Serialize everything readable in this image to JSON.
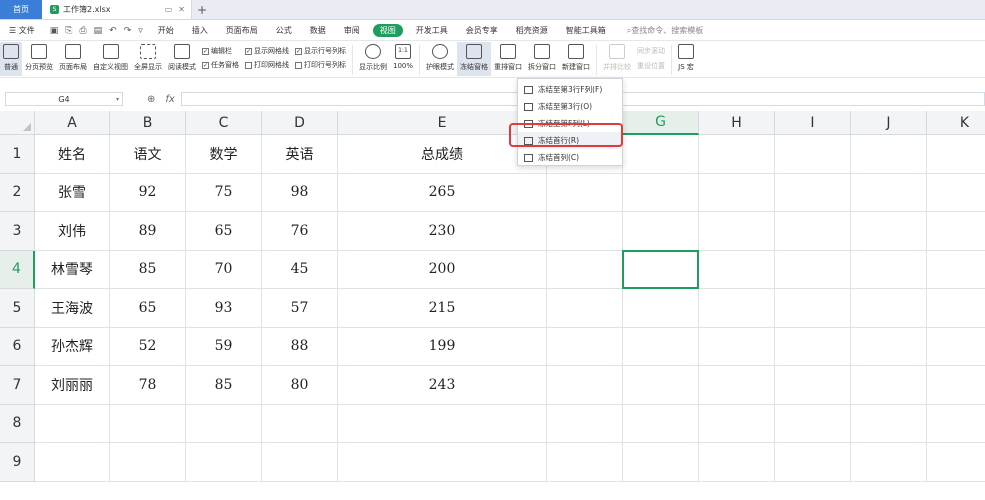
{
  "titlebar": {
    "home_tab": "首页",
    "file_tab": "工作簿2.xlsx",
    "file_icon": "S"
  },
  "menubar": {
    "file": "文件",
    "tabs": [
      "开始",
      "插入",
      "页面布局",
      "公式",
      "数据",
      "审阅"
    ],
    "active_tab": "视图",
    "more_tabs": [
      "开发工具",
      "会员专享",
      "稻壳资源",
      "智能工具箱"
    ],
    "search": "查找命令、搜索模板"
  },
  "toolbar": {
    "normal": "普通",
    "page_break": "分页预览",
    "page_layout": "页面布局",
    "custom_view": "自定义视图",
    "full_screen": "全屏显示",
    "reading_mode": "阅读模式",
    "checks": [
      {
        "label": "编辑栏",
        "checked": true
      },
      {
        "label": "任务窗格",
        "checked": true
      },
      {
        "label": "显示网格线",
        "checked": true
      },
      {
        "label": "打印网格线",
        "checked": false
      },
      {
        "label": "显示行号列标",
        "checked": true
      },
      {
        "label": "打印行号列标",
        "checked": false
      }
    ],
    "zoom": "显示比例",
    "zoom_100": "100%",
    "zoom_100_icon": "1:1",
    "eye_mode": "护眼模式",
    "freeze": "冻结窗格",
    "rearrange": "重排窗口",
    "split": "拆分窗口",
    "new_window": "新建窗口",
    "side_by_side": "并排比较",
    "sync_scroll": "同步滚动",
    "reset_pos": "重设位置",
    "js_macro": "JS 宏"
  },
  "formula_bar": {
    "cell_ref": "G4",
    "fx_label": "fx"
  },
  "freeze_menu": [
    {
      "label": "冻结至第3行F列(F)"
    },
    {
      "label": "冻结至第3行(O)"
    },
    {
      "label": "冻结至第F列(L)"
    },
    {
      "label": "冻结首行(R)"
    },
    {
      "label": "冻结首列(C)"
    }
  ],
  "columns": [
    "A",
    "B",
    "C",
    "D",
    "E",
    "F",
    "G",
    "H",
    "I",
    "J",
    "K"
  ],
  "selected_column": "G",
  "rows": [
    "1",
    "2",
    "3",
    "4",
    "5",
    "6",
    "7",
    "8",
    "9"
  ],
  "selected_row": "4",
  "table": {
    "headers": [
      "姓名",
      "语文",
      "数学",
      "英语",
      "总成绩"
    ],
    "data": [
      [
        "张雪",
        "92",
        "75",
        "98",
        "265"
      ],
      [
        "刘伟",
        "89",
        "65",
        "76",
        "230"
      ],
      [
        "林雪琴",
        "85",
        "70",
        "45",
        "200"
      ],
      [
        "王海波",
        "65",
        "93",
        "57",
        "215"
      ],
      [
        "孙杰辉",
        "52",
        "59",
        "88",
        "199"
      ],
      [
        "刘丽丽",
        "78",
        "85",
        "80",
        "243"
      ]
    ]
  },
  "colors": {
    "accent": "#1e9e5e",
    "highlight": "#e03a3a",
    "home_tab": "#3b7ed8"
  }
}
